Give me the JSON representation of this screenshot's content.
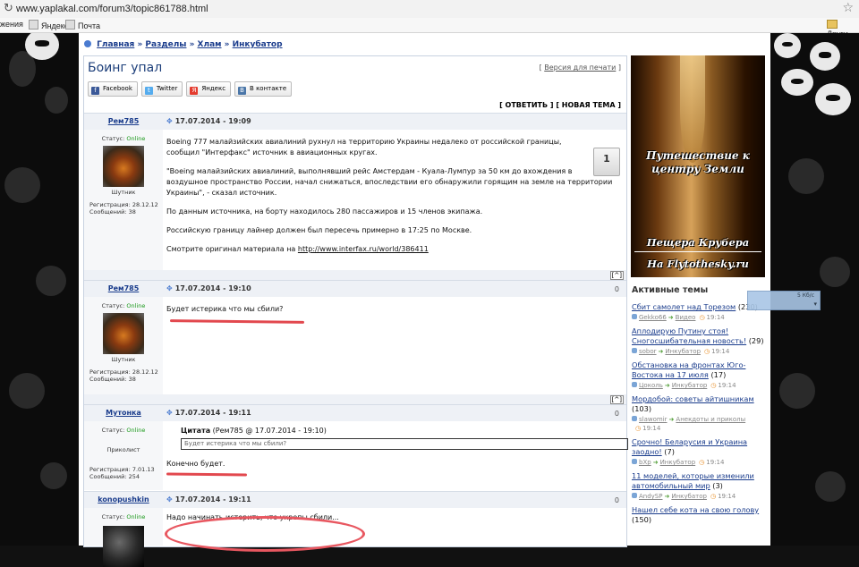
{
  "browser": {
    "url": "www.yaplakal.com/forum3/topic861788.html"
  },
  "bookmarks": {
    "items": [
      "жения",
      "Яндекс",
      "Почта"
    ],
    "other": "Други"
  },
  "breadcrumb": {
    "items": [
      "Главная",
      "Разделы",
      "Хлам",
      "Инкубатор"
    ],
    "sep": "»"
  },
  "topic": {
    "title": "Боинг упал",
    "print_link": "Версия для печати"
  },
  "share": [
    {
      "label": "Facebook",
      "color": "#3b5998",
      "glyph": "f"
    },
    {
      "label": "Twitter",
      "color": "#55acee",
      "glyph": "t"
    },
    {
      "label": "Яндекс",
      "color": "#e43c2f",
      "glyph": "Я"
    },
    {
      "label": "В контакте",
      "color": "#4a76a8",
      "glyph": "B"
    }
  ],
  "actions": {
    "reply": "[ ОТВЕТИТЬ ]",
    "new_topic": "[ НОВАЯ ТЕМА ]"
  },
  "labels": {
    "status": "Статус:",
    "up": "[^]"
  },
  "posts": [
    {
      "author": "Рем785",
      "date": "17.07.2014 - 19:09",
      "status": "Online",
      "role": "Шутник",
      "reg": "Регистрация: 28.12.12",
      "msgs": "Сообщений: 38",
      "vote": "1",
      "paragraphs": [
        "Boeing 777 малайзийских авиалиний рухнул на территорию Украины недалеко от российской границы, сообщил \"Интерфакс\" источник в авиационных кругах.",
        "\"Boeing малайзийских авиалиний, выполнявший рейс Амстердам - Куала-Лумпур за 50 км до вхождения в воздушное пространство России, начал снижаться, впоследствии его обнаружили горящим на земле на территории Украины\", - сказал источник.",
        "По данным источника, на борту находилось 280 пассажиров и 15 членов экипажа.",
        "Российскую границу лайнер должен был пересечь примерно в 17:25 по Москве."
      ],
      "source_text": "Смотрите оригинал материала на",
      "source_link": "http://www.interfax.ru/world/386411"
    },
    {
      "author": "Рем785",
      "date": "17.07.2014 - 19:10",
      "status": "Online",
      "role": "Шутник",
      "reg": "Регистрация: 28.12.12",
      "msgs": "Сообщений: 38",
      "vote": "0",
      "text": "Будет истерика что мы сбили?"
    },
    {
      "author": "Мутонка",
      "date": "17.07.2014 - 19:11",
      "status": "Online",
      "role": "Приколист",
      "reg": "Регистрация: 7.01.13",
      "msgs": "Сообщений: 254",
      "vote": "0",
      "quote_label": "Цитата",
      "quote_meta": "(Рем785 @ 17.07.2014 - 19:10)",
      "quote_text": "Будет истерика что мы сбили?",
      "text": "Конечно будет."
    },
    {
      "author": "konopushkin",
      "date": "17.07.2014 - 19:11",
      "status": "Online",
      "vote": "0",
      "text": "Надо начинать истерить, что укропы сбили..."
    }
  ],
  "banner": {
    "line1": "Путешествие к",
    "line2": "центру Земли",
    "line3": "Пещера Крубера",
    "line4": "На Flytothesky.ru"
  },
  "active_topics": {
    "title": "Активные темы",
    "items": [
      {
        "title": "Сбит самолет над Торезом",
        "count": "(230)",
        "user": "Gekko66",
        "section": "Видео",
        "time": "19:14"
      },
      {
        "title": "Аплодирую Путину стоя! Сногосшибательная новость!",
        "count": "(29)",
        "user": "sobor",
        "section": "Инкубатор",
        "time": "19:14"
      },
      {
        "title": "Обстановка на фронтах Юго-Востока на 17 июля",
        "count": "(17)",
        "user": "Цоколь",
        "section": "Инкубатор",
        "time": "19:14"
      },
      {
        "title": "Мордобой: советы айтишникам",
        "count": "(103)",
        "user": "slawomir",
        "section": "Анекдоты и приколы",
        "time": "19:14"
      },
      {
        "title": "Срочно! Беларусия и Украина заодно!",
        "count": "(7)",
        "user": "bXp",
        "section": "Инкубатор",
        "time": "19:14"
      },
      {
        "title": "11 моделей, которые изменили автомобильный мир",
        "count": "(3)",
        "user": "AndySP",
        "section": "Инкубатор",
        "time": "19:14"
      },
      {
        "title": "Нашел себе кота на свою голову",
        "count": "(150)",
        "user": "",
        "section": "",
        "time": ""
      }
    ]
  },
  "widget": {
    "label": "5 Кб/с"
  }
}
